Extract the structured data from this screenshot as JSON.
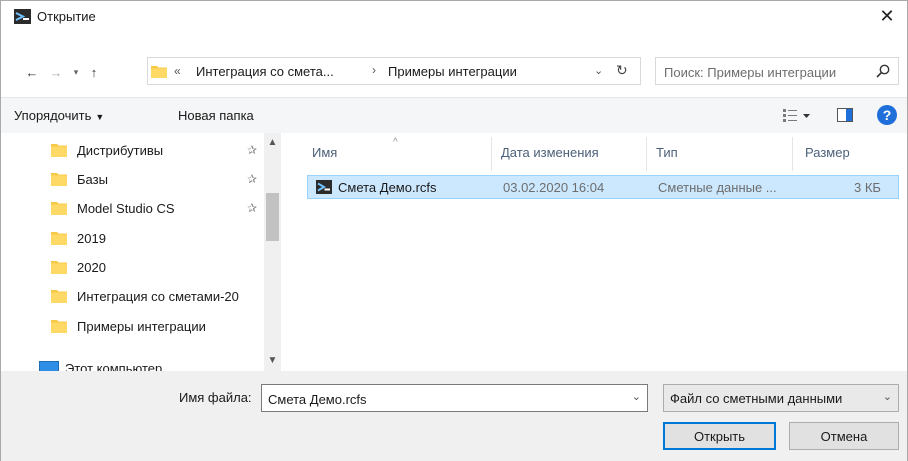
{
  "window": {
    "title": "Открытие",
    "close_symbol": "✕"
  },
  "navigation": {
    "back_symbol": "←",
    "forward_symbol": "→",
    "recent_symbol": "▾",
    "up_symbol": "↑"
  },
  "address": {
    "overflow_symbol": "«",
    "segment1": "Интеграция со смета...",
    "separator": "›",
    "segment2": "Примеры интеграции",
    "dropdown_symbol": "⌄",
    "refresh_symbol": "↻"
  },
  "search": {
    "placeholder": "Поиск: Примеры интеграции"
  },
  "toolbar": {
    "organize_label": "Упорядочить",
    "organize_caret": "▼",
    "new_folder_label": "Новая папка",
    "help_label": "?"
  },
  "sidebar": {
    "items": [
      {
        "label": "Дистрибутивы",
        "pinned": true,
        "icon": "folder-icon"
      },
      {
        "label": "Базы",
        "pinned": true,
        "icon": "folder-icon"
      },
      {
        "label": "Model Studio CS",
        "pinned": true,
        "icon": "folder-icon"
      },
      {
        "label": "2019",
        "pinned": false,
        "icon": "folder-icon"
      },
      {
        "label": "2020",
        "pinned": false,
        "icon": "folder-icon"
      },
      {
        "label": "Интеграция со сметами-20",
        "pinned": false,
        "icon": "folder-icon"
      },
      {
        "label": "Примеры интеграции",
        "pinned": false,
        "icon": "folder-icon"
      },
      {
        "label": "Этот компьютер",
        "pinned": false,
        "icon": "computer-icon"
      }
    ],
    "pin_symbol": "✰",
    "scroll_up": "▲",
    "scroll_down": "▼"
  },
  "filelist": {
    "columns": {
      "name": "Имя",
      "modified": "Дата изменения",
      "type": "Тип",
      "size": "Размер"
    },
    "sort_indicator": "^",
    "files": [
      {
        "name": "Смета Демо.rcfs",
        "modified": "03.02.2020 16:04",
        "type": "Сметные данные ...",
        "size": "3 КБ",
        "selected": true
      }
    ]
  },
  "bottom": {
    "filename_label": "Имя файла:",
    "filename_value": "Смета Демо.rcfs",
    "dropdown_symbol": "⌄",
    "filetype_value": "Файл со сметными данными",
    "open_label": "Открыть",
    "cancel_label": "Отмена"
  },
  "colors": {
    "selection_bg": "#cce8ff",
    "selection_border": "#99d1ff",
    "folder_yellow": "#f7c948",
    "accent": "#0078d7",
    "header_text": "#4c607a"
  }
}
